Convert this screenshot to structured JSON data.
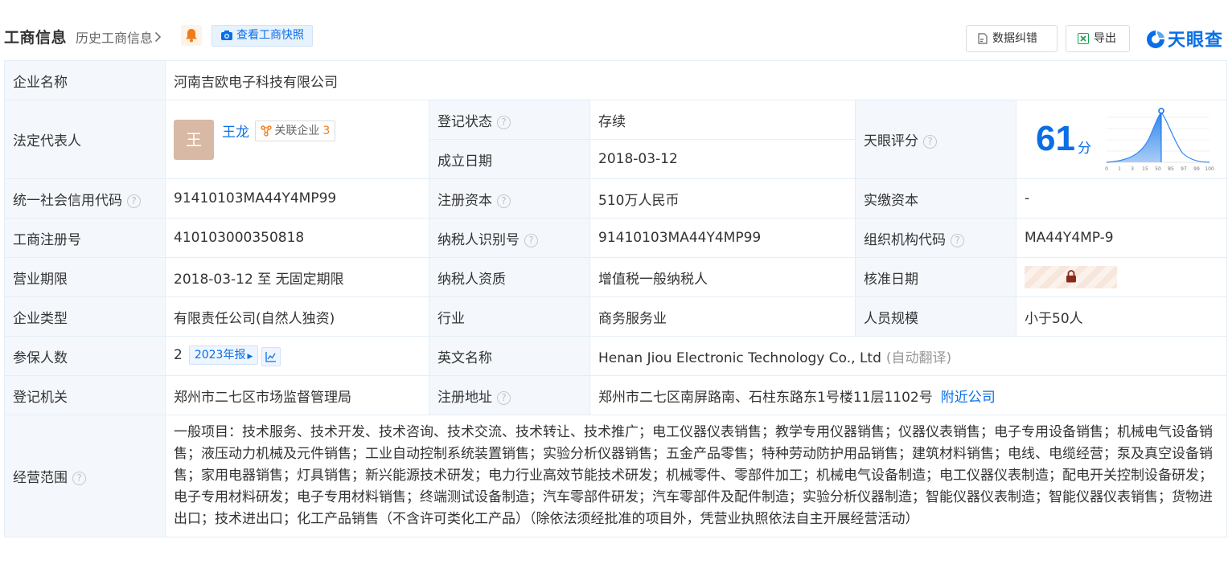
{
  "header": {
    "title": "工商信息",
    "history_label": "历史工商信息",
    "snapshot_label": "查看工商快照",
    "correct_label": "数据纠错",
    "export_label": "导出",
    "logo_text": "天眼查"
  },
  "labels": {
    "company_name": "企业名称",
    "legal_rep": "法定代表人",
    "reg_status": "登记状态",
    "founded": "成立日期",
    "tianyan_score": "天眼评分",
    "credit_code": "统一社会信用代码",
    "reg_capital": "注册资本",
    "paid_capital": "实缴资本",
    "business_reg_no": "工商注册号",
    "taxpayer_id": "纳税人识别号",
    "org_code": "组织机构代码",
    "business_term": "营业期限",
    "taxpayer_type": "纳税人资质",
    "approval_date": "核准日期",
    "company_type": "企业类型",
    "industry": "行业",
    "staff_size": "人员规模",
    "insured": "参保人数",
    "english_name": "英文名称",
    "reg_authority": "登记机关",
    "reg_address": "注册地址",
    "scope": "经营范围"
  },
  "values": {
    "company_name": "河南吉欧电子科技有限公司",
    "avatar_char": "王",
    "legal_rep_name": "王龙",
    "related_label": "关联企业",
    "related_count": "3",
    "reg_status": "存续",
    "founded": "2018-03-12",
    "score": "61",
    "score_unit": "分",
    "credit_code": "91410103MA44Y4MP99",
    "reg_capital": "510万人民币",
    "paid_capital": "-",
    "business_reg_no": "410103000350818",
    "taxpayer_id": "91410103MA44Y4MP99",
    "org_code": "MA44Y4MP-9",
    "business_term": "2018-03-12 至 无固定期限",
    "taxpayer_type": "增值税一般纳税人",
    "company_type": "有限责任公司(自然人独资)",
    "industry": "商务服务业",
    "staff_size": "小于50人",
    "insured": "2",
    "report_year": "2023年报",
    "english_name": "Henan Jiou Electronic Technology Co., Ltd",
    "english_note": "(自动翻译)",
    "reg_authority": "郑州市二七区市场监督管理局",
    "reg_address": "郑州市二七区南屏路南、石柱东路东1号楼11层1102号",
    "nearby_label": "附近公司",
    "scope": "一般项目：技术服务、技术开发、技术咨询、技术交流、技术转让、技术推广；电工仪器仪表销售；教学专用仪器销售；仪器仪表销售；电子专用设备销售；机械电气设备销售；液压动力机械及元件销售；工业自动控制系统装置销售；实验分析仪器销售；五金产品零售；特种劳动防护用品销售；建筑材料销售；电线、电缆经营；泵及真空设备销售；家用电器销售；灯具销售；新兴能源技术研发；电力行业高效节能技术研发；机械零件、零部件加工；机械电气设备制造；电工仪器仪表制造；配电开关控制设备研发；电子专用材料研发；电子专用材料销售；终端测试设备制造；汽车零部件研发；汽车零部件及配件制造；实验分析仪器制造；智能仪器仪表制造；智能仪器仪表销售；货物进出口；技术进出口；化工产品销售（不含许可类化工产品）（除依法须经批准的项目外，凭营业执照依法自主开展经营活动）"
  },
  "score_chart": {
    "ticks": [
      "0",
      "1",
      "3",
      "15",
      "50",
      "85",
      "97",
      "99",
      "100"
    ]
  },
  "colors": {
    "accent": "#0a6fe6",
    "status_green": "#1aa053",
    "label_bg": "#f4f8fd",
    "border": "#e4eef6"
  }
}
